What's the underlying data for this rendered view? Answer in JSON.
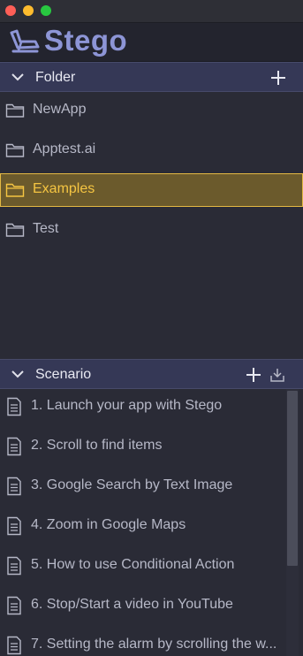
{
  "app": {
    "name": "Stego",
    "brand_color": "#8d95d6"
  },
  "folder_panel": {
    "title": "Folder",
    "items": [
      {
        "label": "NewApp",
        "icon": "folder-icon",
        "selected": false
      },
      {
        "label": "Apptest.ai",
        "icon": "folder-icon",
        "selected": false
      },
      {
        "label": "Examples",
        "icon": "folder-icon",
        "selected": true
      },
      {
        "label": "Test",
        "icon": "folder-icon",
        "selected": false
      }
    ]
  },
  "scenario_panel": {
    "title": "Scenario",
    "items": [
      {
        "label": "1. Launch your app with Stego",
        "icon": "document-icon"
      },
      {
        "label": "2. Scroll to find items",
        "icon": "document-icon"
      },
      {
        "label": "3. Google Search by Text Image",
        "icon": "document-icon"
      },
      {
        "label": "4. Zoom in Google Maps",
        "icon": "document-icon"
      },
      {
        "label": "5. How to use Conditional Action",
        "icon": "document-icon"
      },
      {
        "label": "6. Stop/Start a video in YouTube",
        "icon": "document-icon"
      },
      {
        "label": "7. Setting the alarm by scrolling the w...",
        "icon": "document-icon"
      }
    ]
  },
  "colors": {
    "selected_text": "#f5c542",
    "selected_border": "#e3b843",
    "header_bg": "#353856"
  }
}
